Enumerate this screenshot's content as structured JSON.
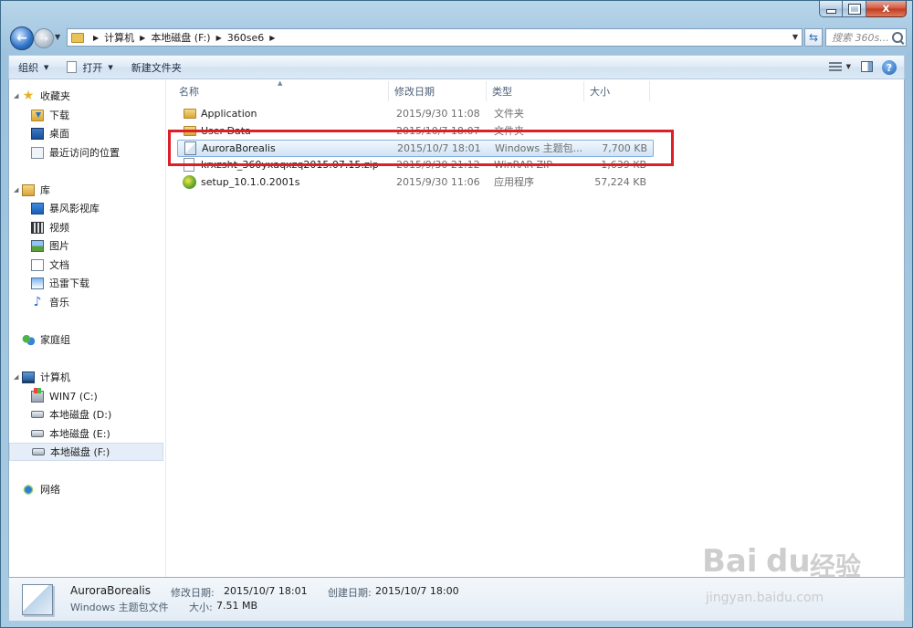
{
  "window": {
    "minimize_label": "–",
    "close_label": "x"
  },
  "address": {
    "crumbs": [
      "计算机",
      "本地磁盘 (F:)",
      "360se6"
    ],
    "search_placeholder": "搜索 360s..."
  },
  "toolbar": {
    "organize": "组织",
    "open": "打开",
    "new_folder": "新建文件夹",
    "help": "?"
  },
  "sidebar": {
    "favorites": {
      "label": "收藏夹",
      "items": [
        "下载",
        "桌面",
        "最近访问的位置"
      ]
    },
    "libraries": {
      "label": "库",
      "items": [
        "暴风影视库",
        "视频",
        "图片",
        "文档",
        "迅雷下载",
        "音乐"
      ]
    },
    "homegroup": {
      "label": "家庭组"
    },
    "computer": {
      "label": "计算机",
      "items": [
        "WIN7 (C:)",
        "本地磁盘 (D:)",
        "本地磁盘 (E:)",
        "本地磁盘 (F:)"
      ],
      "selected_index": 3
    },
    "network": {
      "label": "网络"
    }
  },
  "columns": {
    "name": "名称",
    "date": "修改日期",
    "type": "类型",
    "size": "大小"
  },
  "files": [
    {
      "name": "Application",
      "date": "2015/9/30 11:08",
      "type": "文件夹",
      "size": "",
      "icon": "folder-icon"
    },
    {
      "name": "User Data",
      "date": "2015/10/7 18:07",
      "type": "文件夹",
      "size": "",
      "icon": "folder-icon"
    },
    {
      "name": "AuroraBorealis",
      "date": "2015/10/7 18:01",
      "type": "Windows 主题包...",
      "size": "7,700 KB",
      "icon": "theme-file-icon",
      "selected": true
    },
    {
      "name": "krxzsht_360yxaqxzq2015.07.15.zip",
      "date": "2015/9/30 21:12",
      "type": "WinRAR ZIP",
      "size": "1,639 KB",
      "icon": "zip-file-icon"
    },
    {
      "name": "setup_10.1.0.2001s",
      "date": "2015/9/30 11:06",
      "type": "应用程序",
      "size": "57,224 KB",
      "icon": "setup-exe-icon"
    }
  ],
  "details": {
    "name": "AuroraBorealis",
    "type": "Windows 主题包文件",
    "modified_label": "修改日期:",
    "modified_value": "2015/10/7 18:01",
    "created_label": "创建日期:",
    "created_value": "2015/10/7 18:00",
    "size_label": "大小:",
    "size_value": "7.51 MB"
  },
  "watermark": {
    "brand_a": "Bai",
    "brand_b": "du",
    "brand_c": "经验",
    "url": "jingyan.baidu.com"
  },
  "colors": {
    "highlight": "#dd2027",
    "selection": "#cfe3f5"
  }
}
